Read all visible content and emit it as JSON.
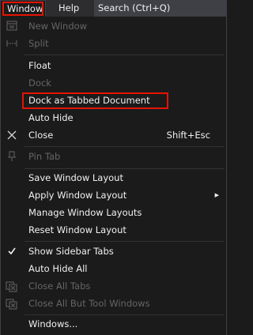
{
  "menubar": {
    "window_label": "Window",
    "help_label": "Help",
    "search_label": "Search (Ctrl+Q)"
  },
  "menu": {
    "items": [
      {
        "label": "New Window",
        "enabled": false,
        "icon": "new-window-icon"
      },
      {
        "label": "Split",
        "enabled": false,
        "icon": "split-icon"
      },
      {
        "label": "Float",
        "enabled": true
      },
      {
        "label": "Dock",
        "enabled": false
      },
      {
        "label": "Dock as Tabbed Document",
        "enabled": true,
        "highlighted": true
      },
      {
        "label": "Auto Hide",
        "enabled": true
      },
      {
        "label": "Close",
        "enabled": true,
        "shortcut": "Shift+Esc",
        "icon": "close-icon"
      },
      {
        "label": "Pin Tab",
        "enabled": false,
        "icon": "pin-icon"
      },
      {
        "label": "Save Window Layout",
        "enabled": true
      },
      {
        "label": "Apply Window Layout",
        "enabled": true,
        "submenu": true
      },
      {
        "label": "Manage Window Layouts",
        "enabled": true
      },
      {
        "label": "Reset Window Layout",
        "enabled": true
      },
      {
        "label": "Show Sidebar Tabs",
        "enabled": true,
        "checked": true,
        "icon": "checkmark-icon"
      },
      {
        "label": "Auto Hide All",
        "enabled": true
      },
      {
        "label": "Close All Tabs",
        "enabled": false,
        "icon": "close-all-tabs-icon"
      },
      {
        "label": "Close All But Tool Windows",
        "enabled": false,
        "icon": "close-all-but-tool-windows-icon"
      },
      {
        "label": "Windows...",
        "enabled": true
      }
    ]
  },
  "colors": {
    "background": "#1b1b1c",
    "text": "#f1f1f1",
    "disabled_text": "#656565",
    "highlight_border": "#e51400"
  }
}
